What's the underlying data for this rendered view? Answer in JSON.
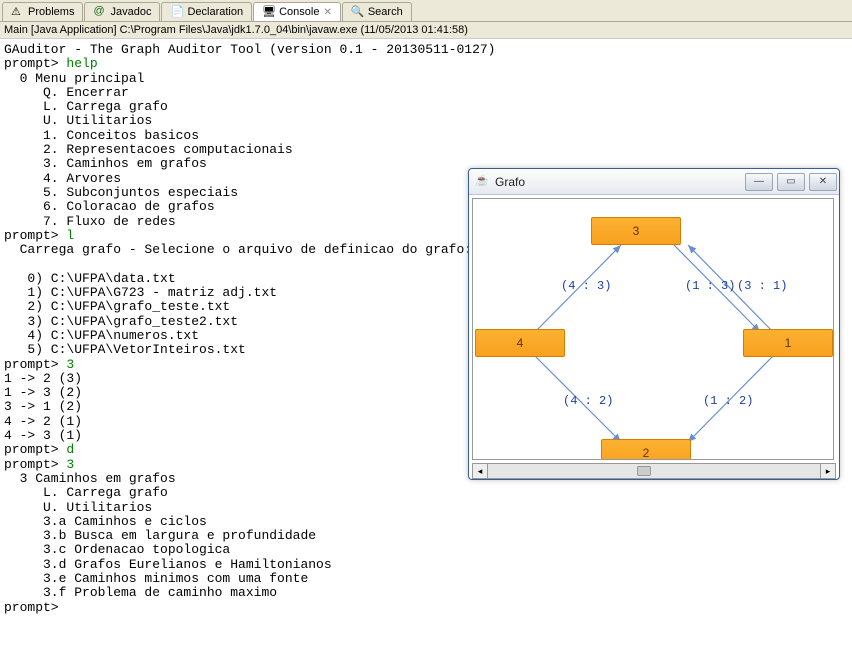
{
  "tabs": [
    {
      "label": "Problems"
    },
    {
      "label": "Javadoc"
    },
    {
      "label": "Declaration"
    },
    {
      "label": "Console",
      "active": true
    },
    {
      "label": "Search"
    }
  ],
  "infobar": "Main [Java Application] C:\\Program Files\\Java\\jdk1.7.0_04\\bin\\javaw.exe (11/05/2013 01:41:58)",
  "console": {
    "intro": "GAuditor - The Graph Auditor Tool (version 0.1 - 20130511-0127)",
    "prompt_label": "prompt>",
    "cmd_help": "help",
    "menu_title": "  0 Menu principal",
    "menu_items": [
      "     Q. Encerrar",
      "     L. Carrega grafo",
      "     U. Utilitarios",
      "     1. Conceitos basicos",
      "     2. Representacoes computacionais",
      "     3. Caminhos em grafos",
      "     4. Arvores",
      "     5. Subconjuntos especiais",
      "     6. Coloracao de grafos",
      "     7. Fluxo de redes"
    ],
    "cmd_l": "l",
    "load_title": "  Carrega grafo - Selecione o arquivo de definicao do grafo:",
    "files": [
      "   0) C:\\UFPA\\data.txt",
      "   1) C:\\UFPA\\G723 - matriz adj.txt",
      "   2) C:\\UFPA\\grafo_teste.txt",
      "   3) C:\\UFPA\\grafo_teste2.txt",
      "   4) C:\\UFPA\\numeros.txt",
      "   5) C:\\UFPA\\VetorInteiros.txt"
    ],
    "cmd_3a": "3",
    "edges": [
      "1 -> 2 (3)",
      "1 -> 3 (2)",
      "3 -> 1 (2)",
      "4 -> 2 (1)",
      "4 -> 3 (1)"
    ],
    "cmd_d": "d",
    "cmd_3b": "3",
    "sect3_title": "  3 Caminhos em grafos",
    "sect3_items": [
      "     L. Carrega grafo",
      "     U. Utilitarios",
      "     3.a Caminhos e ciclos",
      "     3.b Busca em largura e profundidade",
      "     3.c Ordenacao topologica",
      "     3.d Grafos Eurelianos e Hamiltonianos",
      "     3.e Caminhos minimos com uma fonte",
      "     3.f Problema de caminho maximo"
    ]
  },
  "graph_window": {
    "title": "Grafo",
    "nodes": {
      "n1": "1",
      "n2": "2",
      "n3": "3",
      "n4": "4"
    },
    "labels": {
      "e43": "(4 : 3)",
      "e13": "(1 : 3)",
      "e31": "(3 : 1)",
      "e42": "(4 : 2)",
      "e12": "(1 : 2)"
    }
  }
}
